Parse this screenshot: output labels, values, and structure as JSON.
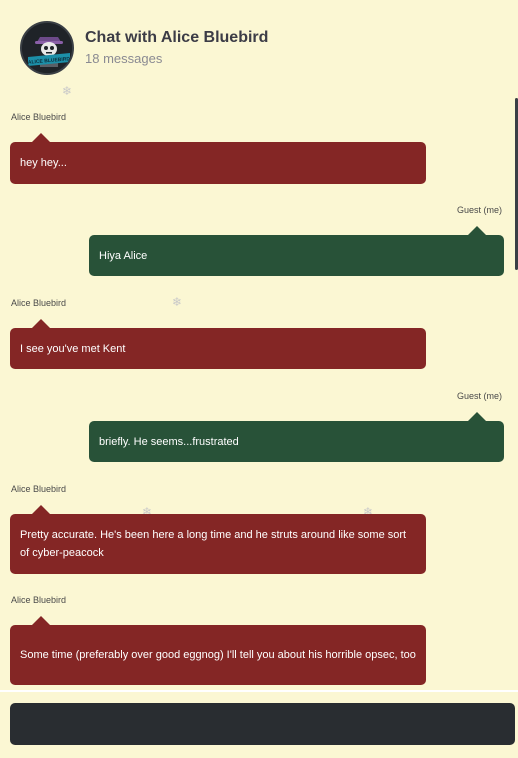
{
  "header": {
    "title": "Chat with Alice Bluebird",
    "message_count": "18 messages",
    "avatar_text": "ALICE BLUEBIRD"
  },
  "messages": [
    {
      "sender": "Alice Bluebird",
      "text": "hey hey...",
      "from_me": false
    },
    {
      "sender": "Guest (me)",
      "text": "Hiya Alice",
      "from_me": true
    },
    {
      "sender": "Alice Bluebird",
      "text": "I see you've met Kent",
      "from_me": false
    },
    {
      "sender": "Guest (me)",
      "text": "briefly. He seems...frustrated",
      "from_me": true
    },
    {
      "sender": "Alice Bluebird",
      "text": "Pretty accurate. He's been here a long time and he struts around like some sort of cyber-peacock",
      "from_me": false
    },
    {
      "sender": "Alice Bluebird",
      "text": "Some time (preferably over good eggnog) I'll tell you about his horrible opsec, too",
      "from_me": false
    }
  ],
  "composer": {
    "value": "",
    "placeholder": ""
  },
  "colors": {
    "background": "#fbf7d3",
    "alice_bubble": "#842625",
    "me_bubble": "#285238",
    "input_bar": "#292d31"
  }
}
